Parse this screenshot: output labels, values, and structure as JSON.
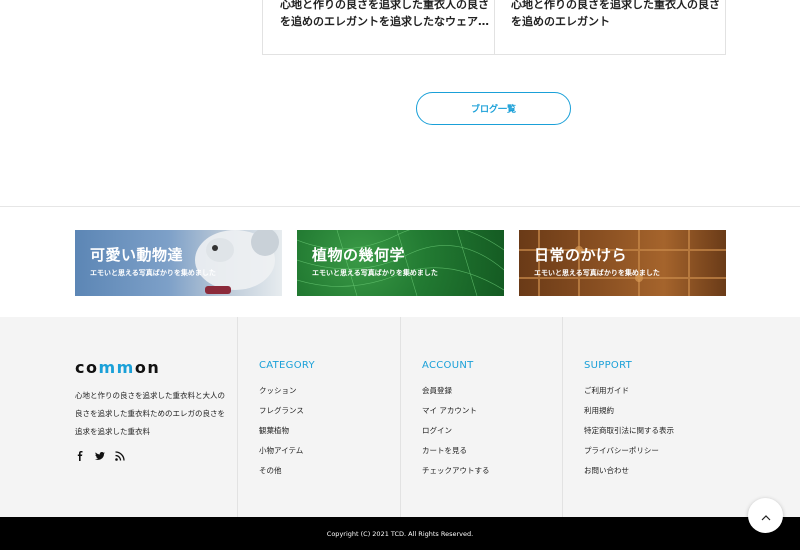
{
  "cards": [
    {
      "text": "心地と作りの良さを追求した重衣人の良さを追めのエレガントを追求したなウェア…"
    },
    {
      "text": "心地と作りの良さを追求した重衣人の良さを追めのエレガント"
    }
  ],
  "blog_button": {
    "label": "ブログ一覧"
  },
  "banners": [
    {
      "title": "可愛い動物達",
      "subtitle": "エモいと思える写真ばかりを集めました"
    },
    {
      "title": "植物の幾何学",
      "subtitle": "エモいと思える写真ばかりを集めました"
    },
    {
      "title": "日常のかけら",
      "subtitle": "エモいと思える写真ばかりを集めました"
    }
  ],
  "footer": {
    "logo": {
      "part1": "co",
      "part2": "mm",
      "part3": "on"
    },
    "about": "心地と作りの良さを追求した重衣料と大人の良さを追求した重衣料ためのエレガの良さを追求を追求した重衣料",
    "social": [
      "facebook-icon",
      "twitter-icon",
      "rss-icon"
    ],
    "columns": [
      {
        "heading": "CATEGORY",
        "items": [
          "クッション",
          "フレグランス",
          "観葉植物",
          "小物アイテム",
          "その他"
        ]
      },
      {
        "heading": "ACCOUNT",
        "items": [
          "会員登録",
          "マイ アカウント",
          "ログイン",
          "カートを見る",
          "チェックアウトする"
        ]
      },
      {
        "heading": "SUPPORT",
        "items": [
          "ご利用ガイド",
          "利用規約",
          "特定商取引法に関する表示",
          "プライバシーポリシー",
          "お問い合わせ"
        ]
      }
    ]
  },
  "copyright": "Copyright (C) 2021 TCD. All Rights Reserved.",
  "colors": {
    "accent": "#1aa0d8",
    "footer_bg": "#f4f4f4",
    "bottom_bar": "#000000"
  }
}
